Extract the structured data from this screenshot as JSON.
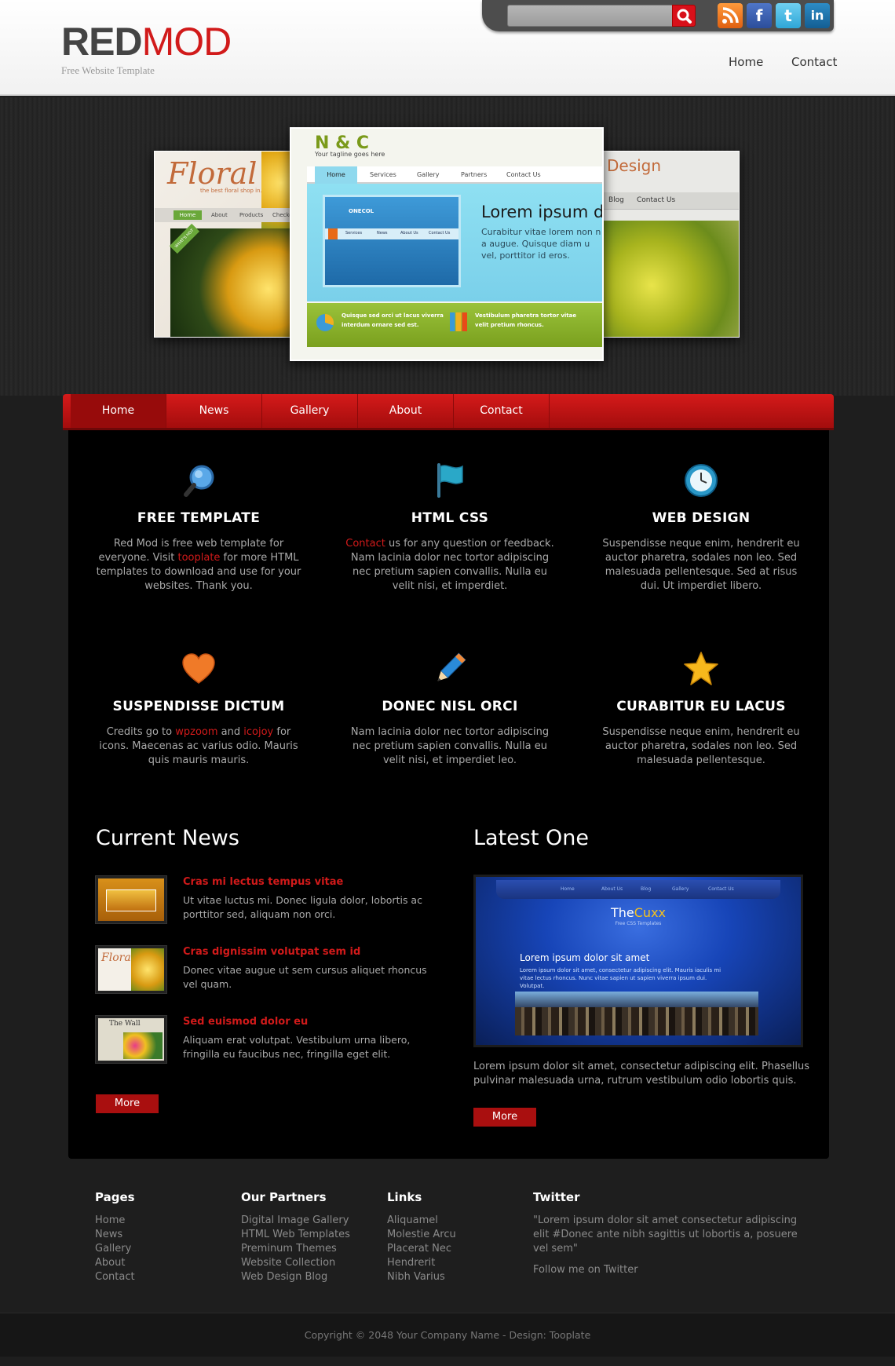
{
  "header": {
    "logo_red": "RED",
    "logo_mod": "MOD",
    "tagline": "Free Website Template",
    "search_placeholder": "",
    "nav": [
      "Home",
      "Contact"
    ],
    "social": [
      {
        "icon": "rss-icon",
        "glyph": "◉"
      },
      {
        "icon": "facebook-icon",
        "glyph": "f"
      },
      {
        "icon": "twitter-icon",
        "glyph": "t"
      },
      {
        "icon": "linkedin-icon",
        "glyph": "in"
      }
    ]
  },
  "slider": {
    "left": {
      "brand": "Floral",
      "tagline": "the best floral shop in...",
      "nav": [
        "Home",
        "About",
        "Products",
        "Checkout"
      ],
      "badge": "WHAT'S HOT"
    },
    "center": {
      "brand": "N & C",
      "tagline": "Your tagline goes here",
      "nav": [
        "Home",
        "Services",
        "Gallery",
        "Partners",
        "Contact Us"
      ],
      "heading": "Lorem ipsum do",
      "text": "Curabitur vitae lorem non n a augue. Quisque diam u vel, porttitor id eros.",
      "inner_brand": "ONECOL",
      "inner_nav": [
        "Services",
        "News",
        "About Us",
        "Contact Us"
      ],
      "bottom_left": "Quisque sed orci ut lacus viverra interdum ornare sed est.",
      "bottom_right": "Vestibulum pharetra tortor vitae velit pretium rhoncus."
    },
    "right": {
      "brand": "Design",
      "nav": [
        "Blog",
        "Contact Us"
      ]
    }
  },
  "main_nav": {
    "items": [
      "Home",
      "News",
      "Gallery",
      "About",
      "Contact"
    ],
    "active_index": 0
  },
  "features": [
    {
      "icon": "magnifier-icon",
      "title": "FREE TEMPLATE",
      "parts": [
        "Red Mod is free web template for everyone. Visit ",
        "tooplate",
        " for more HTML templates to download and use for your websites. Thank you."
      ]
    },
    {
      "icon": "flag-icon",
      "title": "HTML CSS",
      "parts": [
        "",
        "Contact",
        " us for any question or feedback. Nam lacinia dolor nec tortor adipiscing nec pretium sapien convallis. Nulla eu velit nisi, et imperdiet."
      ]
    },
    {
      "icon": "clock-icon",
      "title": "WEB DESIGN",
      "parts": [
        "Suspendisse neque enim, hendrerit eu auctor pharetra, sodales non leo. Sed malesuada pellentesque. Sed at risus dui. Ut imperdiet libero."
      ]
    },
    {
      "icon": "heart-icon",
      "title": "SUSPENDISSE DICTUM",
      "parts": [
        "Credits go to ",
        "wpzoom",
        " and ",
        "icojoy",
        " for icons. Maecenas ac varius odio. Mauris quis mauris mauris."
      ]
    },
    {
      "icon": "pencil-icon",
      "title": "DONEC NISL ORCI",
      "parts": [
        "Nam lacinia dolor nec tortor adipiscing nec pretium sapien convallis. Nulla eu velit nisi, et imperdiet leo."
      ]
    },
    {
      "icon": "star-icon",
      "title": "CURABITUR EU LACUS",
      "parts": [
        "Suspendisse neque enim, hendrerit eu auctor pharetra, sodales non leo. Sed malesuada pellentesque."
      ]
    }
  ],
  "current_news": {
    "title": "Current News",
    "items": [
      {
        "title": "Cras mi lectus tempus vitae",
        "text": "Ut vitae luctus mi. Donec ligula dolor, lobortis ac porttitor sed, aliquam non orci."
      },
      {
        "title": "Cras dignissim volutpat sem id",
        "text": "Donec vitae augue ut sem cursus aliquet rhoncus vel quam.",
        "thumb_text": "Floral"
      },
      {
        "title": "Sed euismod dolor eu",
        "text": "Aliquam erat volutpat. Vestibulum urna libero, fringilla eu faucibus nec, fringilla eget elit.",
        "thumb_text": "The Wall"
      }
    ],
    "more": "More"
  },
  "latest_one": {
    "title": "Latest One",
    "image": {
      "nav": [
        "Home",
        "About Us",
        "Blog",
        "Gallery",
        "Contact Us"
      ],
      "brand_the": "The",
      "brand_cuxx": "Cuxx",
      "brand_sub": "Free CSS Templates",
      "heading": "Lorem ipsum dolor sit amet",
      "text": "Lorem ipsum dolor sit amet, consectetur adipiscing elit. Mauris iaculis mi vitae lectus rhoncus. Nunc vitae sapien ut sapien viverra ipsum dui. Volutpat."
    },
    "text": "Lorem ipsum dolor sit amet, consectetur adipiscing elit. Phasellus pulvinar malesuada urna, rutrum vestibulum odio lobortis quis.",
    "more": "More"
  },
  "footer": {
    "pages": {
      "title": "Pages",
      "links": [
        "Home",
        "News",
        "Gallery",
        "About",
        "Contact"
      ]
    },
    "partners": {
      "title": "Our Partners",
      "links": [
        "Digital Image Gallery",
        "HTML Web Templates",
        "Preminum Themes",
        "Website Collection",
        "Web Design Blog"
      ]
    },
    "links": {
      "title": "Links",
      "links": [
        "Aliquamel",
        "Molestie Arcu",
        "Placerat Nec",
        "Hendrerit",
        "Nibh Varius"
      ]
    },
    "twitter": {
      "title": "Twitter",
      "text": "\"Lorem ipsum dolor sit amet consectetur adipiscing elit #Donec ante nibh sagittis ut lobortis a, posuere vel sem\"",
      "follow": "Follow me on Twitter"
    }
  },
  "copyright": "Copyright © 2048 Your Company Name - Design: Tooplate",
  "colors": {
    "accent": "#d11a1a",
    "nav_red": "#c01414",
    "main_bg": "#000000",
    "page_bg": "#1e1e1e"
  }
}
